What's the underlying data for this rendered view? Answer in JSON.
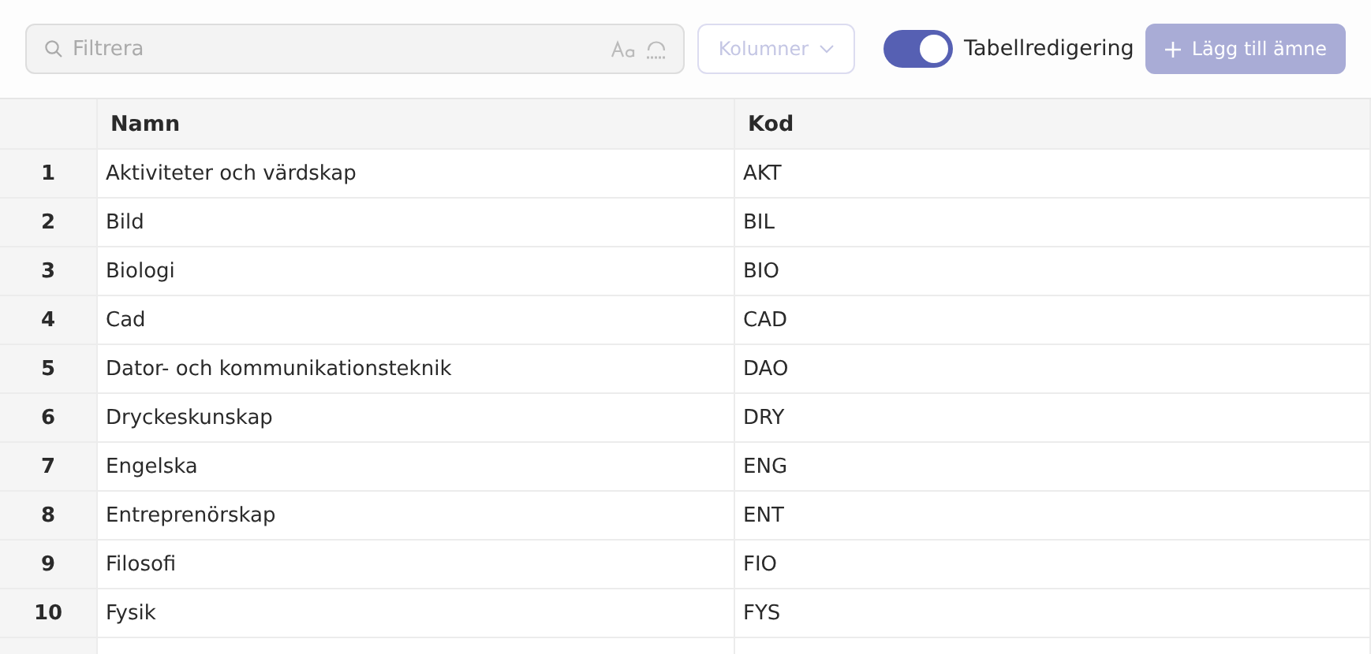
{
  "toolbar": {
    "search": {
      "placeholder": "Filtrera"
    },
    "columns_button": {
      "label": "Kolumner",
      "disabled": true
    },
    "table_edit": {
      "label": "Tabellredigering",
      "on": true
    },
    "add_button": {
      "label": "Lägg till ämne",
      "disabled": true
    }
  },
  "table": {
    "columns": [
      "Namn",
      "Kod"
    ],
    "rows": [
      {
        "index": "1",
        "name": "Aktiviteter och värdskap",
        "code": "AKT"
      },
      {
        "index": "2",
        "name": "Bild",
        "code": "BIL"
      },
      {
        "index": "3",
        "name": "Biologi",
        "code": "BIO"
      },
      {
        "index": "4",
        "name": "Cad",
        "code": "CAD"
      },
      {
        "index": "5",
        "name": "Dator- och kommunikationsteknik",
        "code": "DAO"
      },
      {
        "index": "6",
        "name": "Dryckeskunskap",
        "code": "DRY"
      },
      {
        "index": "7",
        "name": "Engelska",
        "code": "ENG"
      },
      {
        "index": "8",
        "name": "Entreprenörskap",
        "code": "ENT"
      },
      {
        "index": "9",
        "name": "Filosofi",
        "code": "FIO"
      },
      {
        "index": "10",
        "name": "Fysik",
        "code": "FYS"
      }
    ]
  }
}
